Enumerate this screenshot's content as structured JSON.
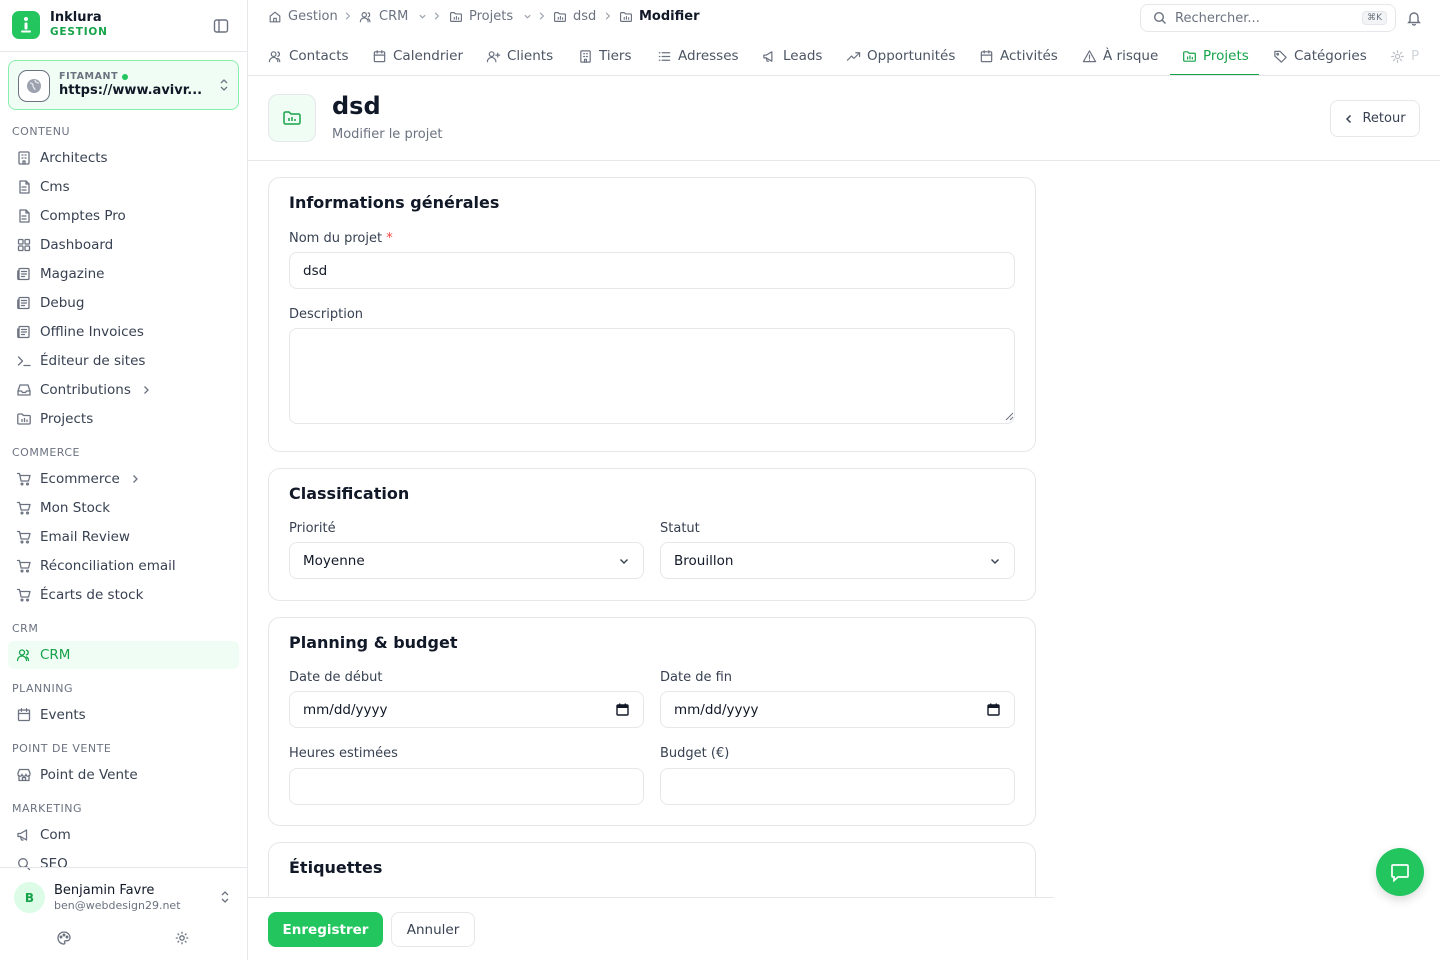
{
  "brand": {
    "name": "Inklura",
    "subtitle": "GESTION"
  },
  "site": {
    "label": "FITAMANT",
    "url": "https://www.avivr..."
  },
  "sidebar": {
    "sections": [
      {
        "label": "CONTENU",
        "items": [
          {
            "label": "Architects",
            "icon": "building-icon"
          },
          {
            "label": "Cms",
            "icon": "file-icon"
          },
          {
            "label": "Comptes Pro",
            "icon": "file-icon"
          },
          {
            "label": "Dashboard",
            "icon": "grid-icon"
          },
          {
            "label": "Magazine",
            "icon": "newspaper-icon"
          },
          {
            "label": "Debug",
            "icon": "newspaper-icon"
          },
          {
            "label": "Offline Invoices",
            "icon": "newspaper-icon"
          },
          {
            "label": "Éditeur de sites",
            "icon": "terminal-icon"
          },
          {
            "label": "Contributions",
            "icon": "inbox-icon"
          },
          {
            "label": "Projects",
            "icon": "folder-icon"
          }
        ]
      },
      {
        "label": "COMMERCE",
        "items": [
          {
            "label": "Ecommerce",
            "icon": "cart-icon"
          },
          {
            "label": "Mon Stock",
            "icon": "cart-icon"
          },
          {
            "label": "Email Review",
            "icon": "cart-icon"
          },
          {
            "label": "Réconciliation email",
            "icon": "cart-icon"
          },
          {
            "label": "Écarts de stock",
            "icon": "cart-icon"
          }
        ]
      },
      {
        "label": "CRM",
        "items": [
          {
            "label": "CRM",
            "icon": "users-icon",
            "active": true
          }
        ]
      },
      {
        "label": "PLANNING",
        "items": [
          {
            "label": "Events",
            "icon": "calendar-icon"
          }
        ]
      },
      {
        "label": "POINT DE VENTE",
        "items": [
          {
            "label": "Point de Vente",
            "icon": "store-icon"
          }
        ]
      },
      {
        "label": "MARKETING",
        "items": [
          {
            "label": "Com",
            "icon": "megaphone-icon"
          },
          {
            "label": "SEO",
            "icon": "search-icon"
          }
        ]
      }
    ]
  },
  "user": {
    "initial": "B",
    "name": "Benjamin Favre",
    "email": "ben@webdesign29.net"
  },
  "breadcrumb": [
    {
      "label": "Gestion",
      "icon": "home-icon"
    },
    {
      "label": "CRM",
      "icon": "users-icon",
      "dropdown": true
    },
    {
      "label": "Projets",
      "icon": "folder-icon",
      "dropdown": true
    },
    {
      "label": "dsd",
      "icon": "folder-icon"
    },
    {
      "label": "Modifier",
      "icon": "folder-icon",
      "current": true
    }
  ],
  "search": {
    "placeholder": "Rechercher...",
    "shortcut": "⌘K"
  },
  "tabs": [
    {
      "label": "Contacts",
      "icon": "users-icon"
    },
    {
      "label": "Calendrier",
      "icon": "calendar-icon"
    },
    {
      "label": "Clients",
      "icon": "user-plus-icon"
    },
    {
      "label": "Tiers",
      "icon": "building-icon"
    },
    {
      "label": "Adresses",
      "icon": "list-icon"
    },
    {
      "label": "Leads",
      "icon": "megaphone-icon"
    },
    {
      "label": "Opportunités",
      "icon": "trending-up-icon"
    },
    {
      "label": "Activités",
      "icon": "calendar-icon"
    },
    {
      "label": "À risque",
      "icon": "warning-icon"
    },
    {
      "label": "Projets",
      "icon": "folder-icon",
      "active": true
    },
    {
      "label": "Catégories",
      "icon": "tag-icon"
    },
    {
      "label": "P",
      "icon": "gear-icon"
    }
  ],
  "page": {
    "title": "dsd",
    "subtitle": "Modifier le projet",
    "back_label": "Retour"
  },
  "form": {
    "general": {
      "title": "Informations générales",
      "name_label": "Nom du projet",
      "required_mark": "*",
      "name_value": "dsd",
      "description_label": "Description",
      "description_value": ""
    },
    "classification": {
      "title": "Classification",
      "priority_label": "Priorité",
      "priority_value": "Moyenne",
      "status_label": "Statut",
      "status_value": "Brouillon"
    },
    "planning": {
      "title": "Planning & budget",
      "start_label": "Date de début",
      "start_value": "mm/dd/yyyy",
      "end_label": "Date de fin",
      "end_value": "mm/dd/yyyy",
      "hours_label": "Heures estimées",
      "hours_value": "",
      "budget_label": "Budget (€)",
      "budget_value": ""
    },
    "tags": {
      "title": "Étiquettes"
    }
  },
  "footer": {
    "save_label": "Enregistrer",
    "cancel_label": "Annuler"
  },
  "colors": {
    "accent": "#22c55e",
    "accent_dark": "#16a34a",
    "accent_bg": "#f0fdf4",
    "border": "#e5e7eb",
    "required": "#ef4444"
  }
}
